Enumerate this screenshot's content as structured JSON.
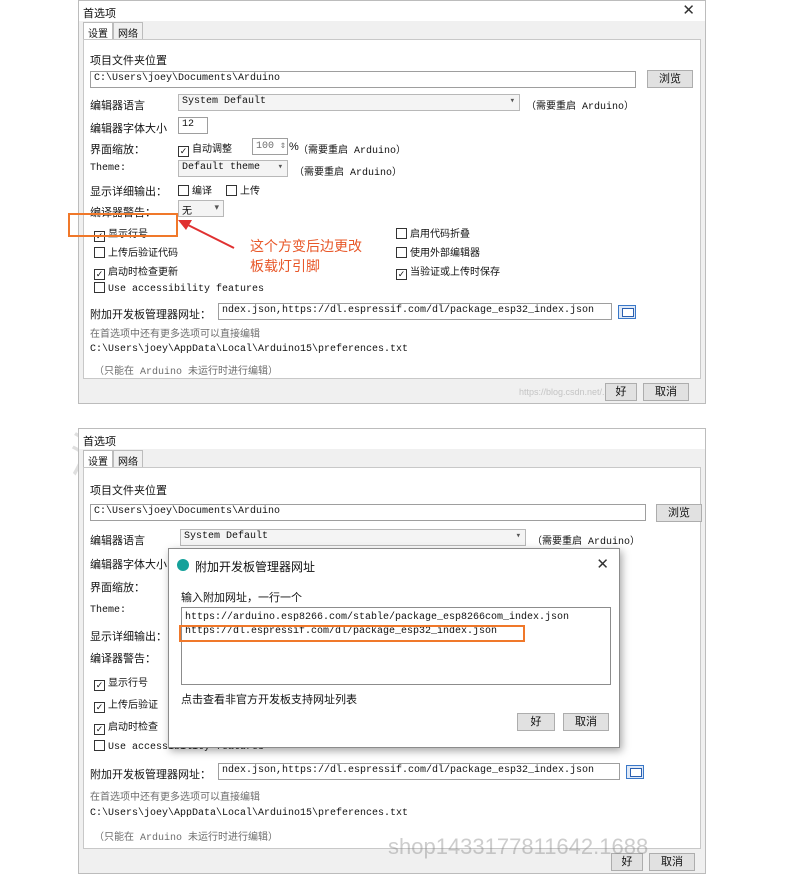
{
  "win1": {
    "title": "首选项",
    "tab_settings": "设置",
    "tab_network": "网络",
    "sketchbook_label": "项目文件夹位置",
    "sketchbook_path": "C:\\Users\\joey\\Documents\\Arduino",
    "browse_label": "浏览",
    "language_label": "编辑器语言",
    "language_value": "System Default",
    "restart_note": "（需要重启 Arduino）",
    "fontsize_label": "编辑器字体大小",
    "fontsize_value": "12",
    "scale_label": "界面缩放：",
    "auto_scale_label": "自动调整",
    "scale_value": "100",
    "percent": "%",
    "scale_restart_note": "（需要重启 Arduino）",
    "theme_label": "Theme:",
    "theme_value": "Default theme",
    "theme_restart_note": "（需要重启 Arduino）",
    "verbose_label": "显示详细输出：",
    "verbose_compile": "编译",
    "verbose_upload": "上传",
    "warnings_label": "编译器警告：",
    "warnings_value": "无",
    "show_line_numbers": "显示行号",
    "enable_folding": "启用代码折叠",
    "verify_after_upload": "上传后验证代码",
    "external_editor": "使用外部编辑器",
    "check_updates": "启动时检查更新",
    "save_on_verify": "当验证或上传时保存",
    "accessibility": "Use accessibility features",
    "boards_url_label": "附加开发板管理器网址：",
    "boards_url_value": "ndex.json,https://dl.espressif.com/dl/package_esp32_index.json",
    "more_prefs": "在首选项中还有更多选项可以直接编辑",
    "prefs_path": "C:\\Users\\joey\\AppData\\Local\\Arduino15\\preferences.txt",
    "edit_note": "（只能在 Arduino 未运行时进行编辑）",
    "ok_label": "好",
    "cancel_label": "取消",
    "blog_watermark": "https://blog.csdn.net/..."
  },
  "annotation": {
    "line1": "这个方变后边更改",
    "line2": "板载灯引脚"
  },
  "win2": {
    "title": "首选项",
    "tab_settings": "设置",
    "tab_network": "网络",
    "sketchbook_label": "项目文件夹位置",
    "sketchbook_path": "C:\\Users\\joey\\Documents\\Arduino",
    "browse_label": "浏览",
    "language_label": "编辑器语言",
    "language_value": "System Default",
    "restart_note": "（需要重启 Arduino）",
    "fontsize_label": "编辑器字体大小",
    "scale_label": "界面缩放：",
    "theme_label": "Theme:",
    "verbose_label": "显示详细输出：",
    "warnings_label": "编译器警告：",
    "show_line_numbers": "显示行号",
    "verify_after_upload": "上传后验证",
    "check_updates": "启动时检查",
    "accessibility": "Use accessibility features",
    "boards_url_label": "附加开发板管理器网址：",
    "boards_url_value": "ndex.json,https://dl.espressif.com/dl/package_esp32_index.json",
    "more_prefs": "在首选项中还有更多选项可以直接编辑",
    "prefs_path": "C:\\Users\\joey\\AppData\\Local\\Arduino15\\preferences.txt",
    "edit_note": "（只能在 Arduino 未运行时进行编辑）",
    "ok_label": "好",
    "cancel_label": "取消"
  },
  "dialog": {
    "title": "附加开发板管理器网址",
    "prompt": "输入附加网址，一行一个",
    "urls": [
      "https://arduino.esp8266.com/stable/package_esp8266com_index.json",
      "https://dl.espressif.com/dl/package_esp32_index.json"
    ],
    "link_text": "点击查看非官方开发板支持网址列表",
    "ok_label": "好",
    "cancel_label": "取消"
  },
  "watermark": {
    "company": "深圳市宏维微电子有限公司",
    "shop": "shop1433177811642.1688"
  },
  "colors": {
    "highlight": "#f0782a",
    "annotation_text": "#e8582a",
    "arrow": "#e03030"
  }
}
